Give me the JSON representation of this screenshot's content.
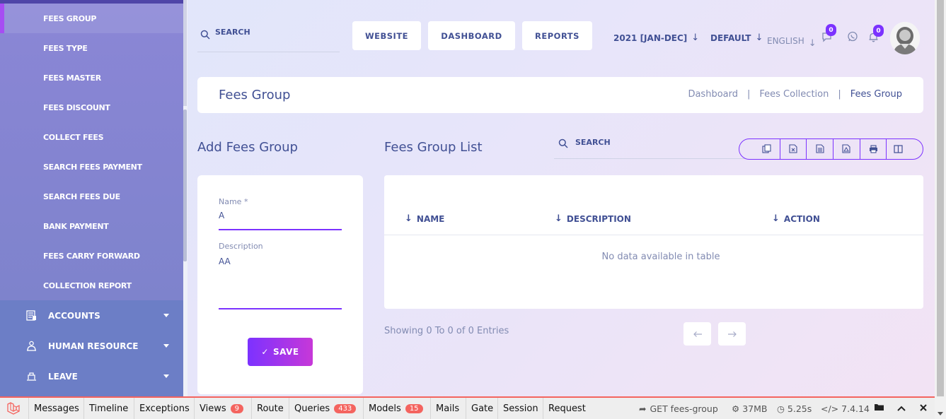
{
  "sidebar": {
    "fees_items": [
      "FEES GROUP",
      "FEES TYPE",
      "FEES MASTER",
      "FEES DISCOUNT",
      "COLLECT FEES",
      "SEARCH FEES PAYMENT",
      "SEARCH FEES DUE",
      "BANK PAYMENT",
      "FEES CARRY FORWARD",
      "COLLECTION REPORT"
    ],
    "active_item": "FEES GROUP",
    "main_items": [
      {
        "label": "ACCOUNTS",
        "icon": "accounts-icon"
      },
      {
        "label": "HUMAN RESOURCE",
        "icon": "human-resource-icon"
      },
      {
        "label": "LEAVE",
        "icon": "leave-icon"
      }
    ]
  },
  "header": {
    "search_placeholder": "SEARCH",
    "buttons": {
      "website": "WEBSITE",
      "dashboard": "DASHBOARD",
      "reports": "REPORTS"
    },
    "session": "2021 [JAN-DEC]",
    "style": "DEFAULT",
    "language": "ENGLISH",
    "message_count": "0",
    "notification_count": "0"
  },
  "page": {
    "title": "Fees Group",
    "breadcrumb": {
      "home": "Dashboard",
      "parent": "Fees Collection",
      "current": "Fees Group",
      "separator": "|"
    }
  },
  "form": {
    "heading": "Add Fees Group",
    "name_label": "Name *",
    "name_value": "A",
    "description_label": "Description",
    "description_value": "AA",
    "save_label": "SAVE"
  },
  "list": {
    "heading": "Fees Group List",
    "search_placeholder": "SEARCH",
    "export_buttons": [
      "copy-icon",
      "excel-icon",
      "csv-icon",
      "pdf-icon",
      "print-icon",
      "columns-icon"
    ],
    "columns": [
      "NAME",
      "DESCRIPTION",
      "ACTION"
    ],
    "rows": [],
    "empty_message": "No data available in table",
    "entries_info": "Showing 0 To 0 of 0 Entries"
  },
  "debugbar": {
    "tabs": [
      {
        "label": "Messages",
        "count": ""
      },
      {
        "label": "Timeline",
        "count": ""
      },
      {
        "label": "Exceptions",
        "count": ""
      },
      {
        "label": "Views",
        "count": "9"
      },
      {
        "label": "Route",
        "count": ""
      },
      {
        "label": "Queries",
        "count": "433"
      },
      {
        "label": "Models",
        "count": "15"
      },
      {
        "label": "Mails",
        "count": ""
      },
      {
        "label": "Gate",
        "count": ""
      },
      {
        "label": "Session",
        "count": ""
      },
      {
        "label": "Request",
        "count": ""
      }
    ],
    "request": "GET fees-group",
    "memory": "37MB",
    "time": "5.25s",
    "php_version": "7.4.14"
  },
  "colors": {
    "primary": "#7c32ff",
    "accent": "#c738d8",
    "text": "#415094",
    "muted": "#828bb2",
    "debug_red": "#f4645f"
  }
}
